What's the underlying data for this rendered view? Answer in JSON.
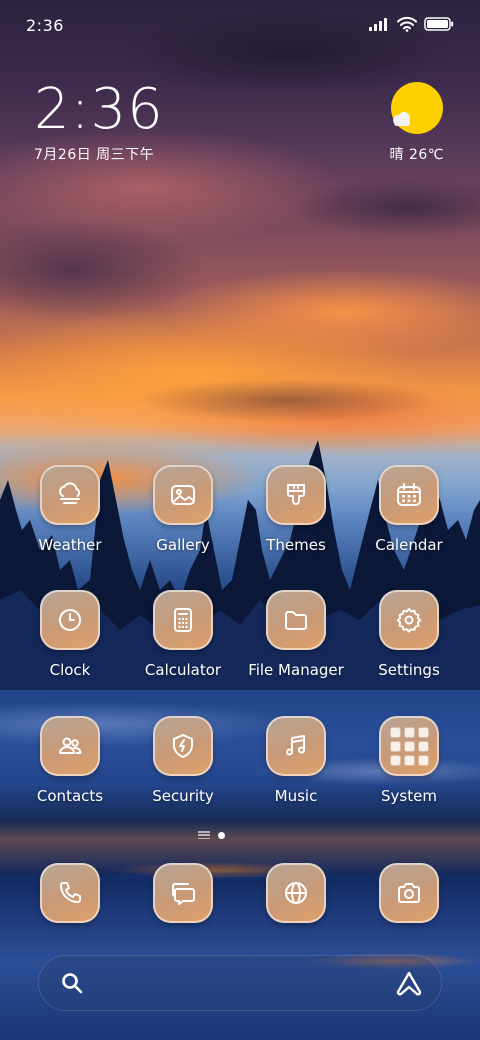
{
  "status_bar": {
    "time": "2:36",
    "icons": [
      "signal-icon",
      "wifi-icon",
      "battery-icon"
    ]
  },
  "clock_widget": {
    "time": "2:36",
    "date": "7月26日 周三下午"
  },
  "weather_widget": {
    "condition_icon": "sun-cloud-icon",
    "text": "晴 26℃"
  },
  "apps": [
    {
      "label": "Weather",
      "icon": "weather-fog-icon"
    },
    {
      "label": "Gallery",
      "icon": "gallery-icon"
    },
    {
      "label": "Themes",
      "icon": "brush-icon"
    },
    {
      "label": "Calendar",
      "icon": "calendar-icon"
    },
    {
      "label": "Clock",
      "icon": "clock-icon"
    },
    {
      "label": "Calculator",
      "icon": "calculator-icon"
    },
    {
      "label": "File Manager",
      "icon": "folder-icon"
    },
    {
      "label": "Settings",
      "icon": "gear-icon"
    },
    {
      "label": "Contacts",
      "icon": "contacts-icon"
    },
    {
      "label": "Security",
      "icon": "shield-bolt-icon"
    },
    {
      "label": "Music",
      "icon": "music-note-icon"
    },
    {
      "label": "System",
      "icon": "folder-grid-icon"
    }
  ],
  "dock": [
    {
      "icon": "phone-icon"
    },
    {
      "icon": "messages-icon"
    },
    {
      "icon": "browser-globe-icon"
    },
    {
      "icon": "camera-icon"
    }
  ],
  "page_indicator": {
    "pages": 2,
    "current": 2
  },
  "search_bar": {
    "left_icon": "search-icon",
    "right_icon": "assistant-icon"
  },
  "colors": {
    "icon_gradient_start": "#b6a597",
    "icon_gradient_end": "#e0a16a",
    "weather_sun": "#ffd000"
  }
}
